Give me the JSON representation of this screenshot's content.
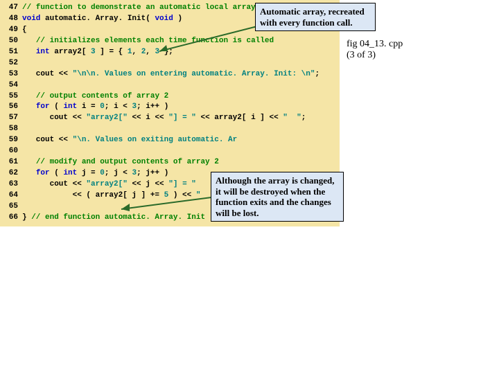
{
  "lines": [
    {
      "n": "47",
      "seg": [
        {
          "t": "// function to demonstrate an automatic local array",
          "c": "c-comment"
        }
      ]
    },
    {
      "n": "48",
      "seg": [
        {
          "t": "void",
          "c": "c-keyword"
        },
        {
          "t": " automatic. Array. Init( ",
          "c": "c-plain"
        },
        {
          "t": "void",
          "c": "c-keyword"
        },
        {
          "t": " )",
          "c": "c-plain"
        }
      ]
    },
    {
      "n": "49",
      "seg": [
        {
          "t": "{",
          "c": "c-plain"
        }
      ]
    },
    {
      "n": "50",
      "seg": [
        {
          "t": "   ",
          "c": "c-plain"
        },
        {
          "t": "// initializes elements each time function is called",
          "c": "c-comment"
        }
      ]
    },
    {
      "n": "51",
      "seg": [
        {
          "t": "   ",
          "c": "c-plain"
        },
        {
          "t": "int",
          "c": "c-keyword"
        },
        {
          "t": " array2[ ",
          "c": "c-plain"
        },
        {
          "t": "3",
          "c": "c-num"
        },
        {
          "t": " ] = { ",
          "c": "c-plain"
        },
        {
          "t": "1",
          "c": "c-num"
        },
        {
          "t": ", ",
          "c": "c-plain"
        },
        {
          "t": "2",
          "c": "c-num"
        },
        {
          "t": ", ",
          "c": "c-plain"
        },
        {
          "t": "3",
          "c": "c-num"
        },
        {
          "t": " };",
          "c": "c-plain"
        }
      ]
    },
    {
      "n": "52",
      "seg": [
        {
          "t": "",
          "c": "c-plain"
        }
      ]
    },
    {
      "n": "53",
      "seg": [
        {
          "t": "   cout << ",
          "c": "c-plain"
        },
        {
          "t": "\"\\n\\n. Values on entering automatic. Array. Init: \\n\"",
          "c": "c-str"
        },
        {
          "t": ";",
          "c": "c-plain"
        }
      ]
    },
    {
      "n": "54",
      "seg": [
        {
          "t": "",
          "c": "c-plain"
        }
      ]
    },
    {
      "n": "55",
      "seg": [
        {
          "t": "   ",
          "c": "c-plain"
        },
        {
          "t": "// output contents of array 2",
          "c": "c-comment"
        }
      ]
    },
    {
      "n": "56",
      "seg": [
        {
          "t": "   ",
          "c": "c-plain"
        },
        {
          "t": "for",
          "c": "c-keyword"
        },
        {
          "t": " ( ",
          "c": "c-plain"
        },
        {
          "t": "int",
          "c": "c-keyword"
        },
        {
          "t": " i = ",
          "c": "c-plain"
        },
        {
          "t": "0",
          "c": "c-num"
        },
        {
          "t": "; i < ",
          "c": "c-plain"
        },
        {
          "t": "3",
          "c": "c-num"
        },
        {
          "t": "; i++ )",
          "c": "c-plain"
        }
      ]
    },
    {
      "n": "57",
      "seg": [
        {
          "t": "      cout << ",
          "c": "c-plain"
        },
        {
          "t": "\"array2[\"",
          "c": "c-str"
        },
        {
          "t": " << i << ",
          "c": "c-plain"
        },
        {
          "t": "\"] = \"",
          "c": "c-str"
        },
        {
          "t": " << array2[ i ] << ",
          "c": "c-plain"
        },
        {
          "t": "\"  \"",
          "c": "c-str"
        },
        {
          "t": ";",
          "c": "c-plain"
        }
      ]
    },
    {
      "n": "58",
      "seg": [
        {
          "t": "",
          "c": "c-plain"
        }
      ]
    },
    {
      "n": "59",
      "seg": [
        {
          "t": "   cout << ",
          "c": "c-plain"
        },
        {
          "t": "\"\\n. Values on exiting automatic. Ar",
          "c": "c-str"
        }
      ]
    },
    {
      "n": "60",
      "seg": [
        {
          "t": "",
          "c": "c-plain"
        }
      ]
    },
    {
      "n": "61",
      "seg": [
        {
          "t": "   ",
          "c": "c-plain"
        },
        {
          "t": "// modify and output contents of array 2",
          "c": "c-comment"
        }
      ]
    },
    {
      "n": "62",
      "seg": [
        {
          "t": "   ",
          "c": "c-plain"
        },
        {
          "t": "for",
          "c": "c-keyword"
        },
        {
          "t": " ( ",
          "c": "c-plain"
        },
        {
          "t": "int",
          "c": "c-keyword"
        },
        {
          "t": " j = ",
          "c": "c-plain"
        },
        {
          "t": "0",
          "c": "c-num"
        },
        {
          "t": "; j < ",
          "c": "c-plain"
        },
        {
          "t": "3",
          "c": "c-num"
        },
        {
          "t": "; j++ )",
          "c": "c-plain"
        }
      ]
    },
    {
      "n": "63",
      "seg": [
        {
          "t": "      cout << ",
          "c": "c-plain"
        },
        {
          "t": "\"array2[\"",
          "c": "c-str"
        },
        {
          "t": " << j << ",
          "c": "c-plain"
        },
        {
          "t": "\"] = \"",
          "c": "c-str"
        }
      ]
    },
    {
      "n": "64",
      "seg": [
        {
          "t": "           << ( array2[ j ] += ",
          "c": "c-plain"
        },
        {
          "t": "5",
          "c": "c-num"
        },
        {
          "t": " ) << ",
          "c": "c-plain"
        },
        {
          "t": "\"  \"",
          "c": "c-str"
        },
        {
          "t": ";",
          "c": "c-plain"
        }
      ]
    },
    {
      "n": "65",
      "seg": [
        {
          "t": "",
          "c": "c-plain"
        }
      ]
    },
    {
      "n": "66",
      "seg": [
        {
          "t": "} ",
          "c": "c-plain"
        },
        {
          "t": "// end function automatic. Array. Init",
          "c": "c-comment"
        }
      ]
    }
  ],
  "callout1": "Automatic array, recreated with every function call.",
  "callout2": "Although the array is changed, it will be destroyed when the function exits and the changes will be lost.",
  "side1": "fig 04_13. cpp",
  "side2": "(3 of 3)"
}
